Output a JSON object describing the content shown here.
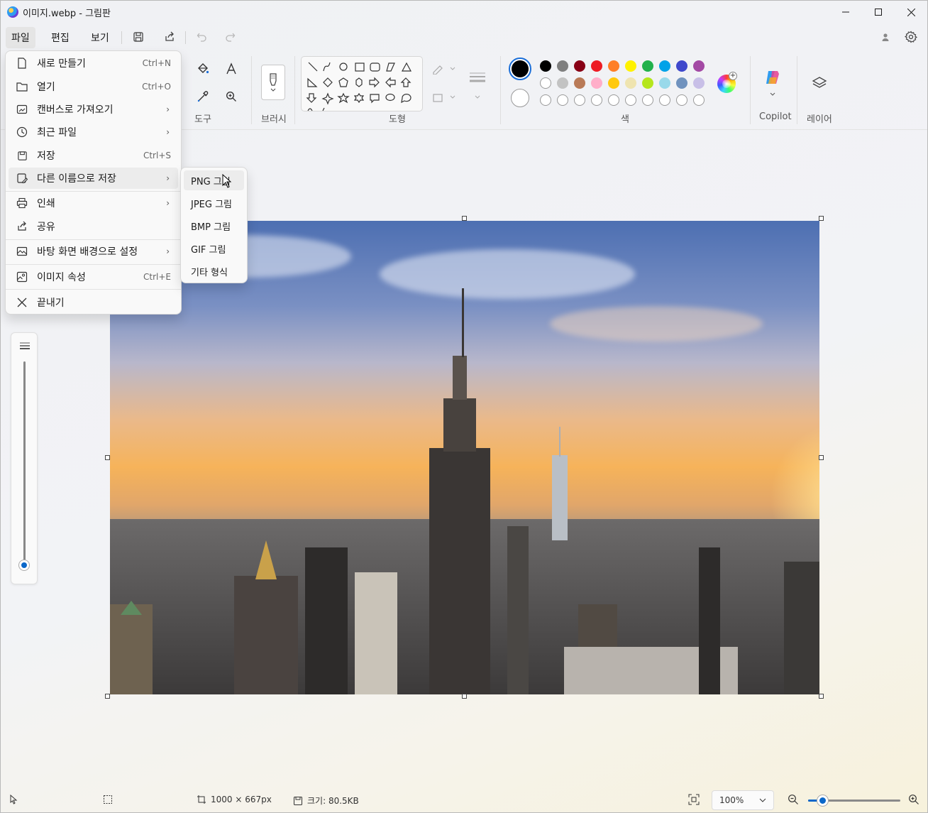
{
  "window": {
    "title": "이미지.webp - 그림판"
  },
  "menubar": {
    "file": "파일",
    "edit": "편집",
    "view": "보기"
  },
  "ribbon": {
    "tools_label": "도구",
    "brushes_label": "브러시",
    "shapes_label": "도형",
    "colors_label": "색",
    "copilot_label": "Copilot",
    "layers_label": "레이어",
    "palette_row1": [
      "#000000",
      "#7f7f7f",
      "#880015",
      "#ed1c24",
      "#ff7f27",
      "#fff200",
      "#22b14c",
      "#00a2e8",
      "#3f48cc",
      "#a349a4"
    ],
    "palette_row2": [
      "#ffffff",
      "#c3c3c3",
      "#b97a57",
      "#ffaec9",
      "#ffc90e",
      "#efe4b0",
      "#b5e61d",
      "#99d9ea",
      "#7092be",
      "#c8bfe7"
    ]
  },
  "file_menu": {
    "items": [
      {
        "label": "새로 만들기",
        "shortcut": "Ctrl+N",
        "icon": "new-file-icon"
      },
      {
        "label": "열기",
        "shortcut": "Ctrl+O",
        "icon": "folder-icon"
      },
      {
        "label": "캔버스로 가져오기",
        "shortcut": "",
        "icon": "import-icon"
      },
      {
        "label": "최근 파일",
        "shortcut": "",
        "icon": "clock-icon"
      },
      {
        "label": "저장",
        "shortcut": "Ctrl+S",
        "icon": "save-icon"
      },
      {
        "label": "다른 이름으로 저장",
        "shortcut": "",
        "icon": "save-as-icon"
      },
      {
        "label": "인쇄",
        "shortcut": "",
        "icon": "printer-icon"
      },
      {
        "label": "공유",
        "shortcut": "",
        "icon": "share-icon"
      },
      {
        "label": "바탕 화면 배경으로 설정",
        "shortcut": "",
        "icon": "desktop-icon"
      },
      {
        "label": "이미지 속성",
        "shortcut": "Ctrl+E",
        "icon": "image-properties-icon"
      },
      {
        "label": "끝내기",
        "shortcut": "",
        "icon": "close-icon"
      }
    ]
  },
  "save_as_menu": {
    "items": [
      "PNG 그림",
      "JPEG 그림",
      "BMP 그림",
      "GIF 그림",
      "기타 형식"
    ]
  },
  "status": {
    "dimensions": "1000 × 667px",
    "size": "크기: 80.5KB",
    "zoom": "100%"
  }
}
